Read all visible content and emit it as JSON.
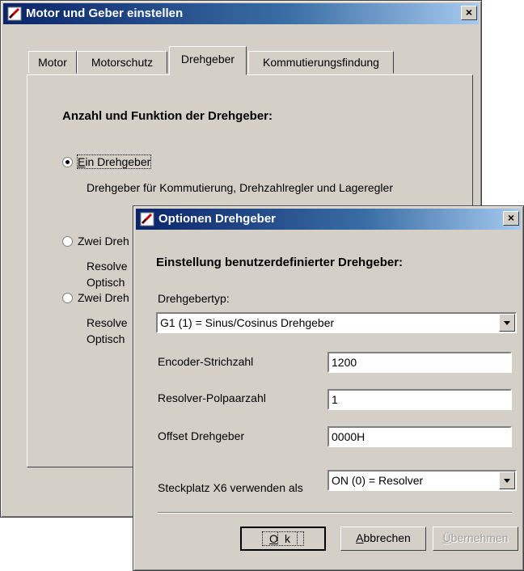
{
  "main_window": {
    "title": "Motor und Geber einstellen",
    "close_glyph": "×",
    "tabs": [
      {
        "label": "Motor"
      },
      {
        "label": "Motorschutz"
      },
      {
        "label": "Drehgeber"
      },
      {
        "label": "Kommutierungsfindung"
      }
    ],
    "section_title": "Anzahl und Funktion der Drehgeber:",
    "options": [
      {
        "label_first": "E",
        "label_rest": "in Drehgeber",
        "checked": true,
        "desc1": "Drehgeber für Kommutierung, Drehzahlregler und Lageregler"
      },
      {
        "label": "Zwei Dreh",
        "checked": false,
        "desc1": "Resolve",
        "desc2": "Optisch"
      },
      {
        "label": "Zwei Dreh",
        "checked": false,
        "desc1": "Resolve",
        "desc2": "Optisch"
      }
    ]
  },
  "dialog": {
    "title": "Optionen Drehgeber",
    "close_glyph": "×",
    "heading": "Einstellung benutzerdefinierter Drehgeber:",
    "type_label": "Drehgebertyp:",
    "type_value": "G1 (1) = Sinus/Cosinus Drehgeber",
    "fields": [
      {
        "label": "Encoder-Strichzahl",
        "value": "1200"
      },
      {
        "label": "Resolver-Polpaarzahl",
        "value": "1"
      },
      {
        "label": "Offset Drehgeber",
        "value": "0000H"
      }
    ],
    "slot_label": "Steckplatz X6 verwenden als",
    "slot_value": "ON (0) = Resolver",
    "buttons": {
      "ok_first": "O",
      "ok_rest": "k",
      "cancel_first": "A",
      "cancel_rest": "bbrechen",
      "apply_first": "Ü",
      "apply_rest": "bernehmen"
    }
  },
  "colors": {
    "title_bar_start": "#0a246a",
    "title_bar_end": "#a6caf0",
    "face": "#d4d0c8"
  }
}
